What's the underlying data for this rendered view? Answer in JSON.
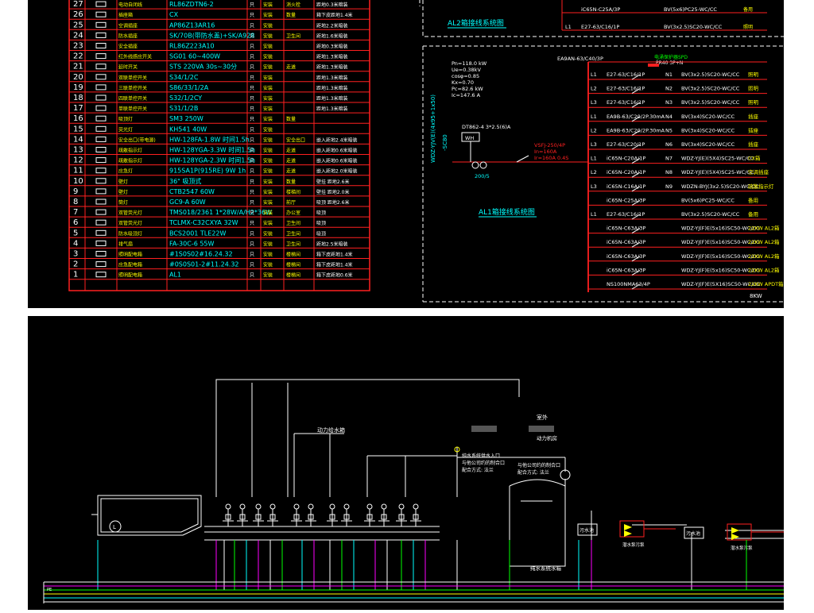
{
  "top": {
    "legend_rows": [
      {
        "no": "27",
        "name": "电动自闭线",
        "model": "RL86ZDTN6-2",
        "unit": "只",
        "install": "距地0.3米暗装",
        "qty": "",
        "mark": "消火栓"
      },
      {
        "no": "26",
        "name": "插座箱",
        "model": "CX",
        "unit": "只",
        "install": "箱下皮距地1.4米",
        "qty": "",
        "mark": "数量"
      },
      {
        "no": "25",
        "name": "空调插座",
        "model": "AP86Z13AR16",
        "unit": "只",
        "install": "距地2.2米暗装",
        "qty": "",
        "mark": ""
      },
      {
        "no": "24",
        "name": "防水插座",
        "model": "SK/70B(带防水盖)+SK/A928",
        "unit": "只",
        "install": "距地1.6米暗装",
        "qty": "",
        "mark": "卫生间"
      },
      {
        "no": "23",
        "name": "安全插座",
        "model": "RL86Z223A10",
        "unit": "只",
        "install": "距地0.3米暗装",
        "qty": "",
        "mark": ""
      },
      {
        "no": "22",
        "name": "红外线感应开关",
        "model": "SG01 60~400W",
        "unit": "只",
        "install": "距地1.3米暗装",
        "qty": "",
        "mark": ""
      },
      {
        "no": "21",
        "name": "延时开关",
        "model": "STS 220VA 30s~30分",
        "unit": "只",
        "install": "距地1.3米暗装",
        "qty": "",
        "mark": "走道"
      },
      {
        "no": "20",
        "name": "双联单控开关",
        "model": "S34/1/2C",
        "unit": "只",
        "install": "距地1.3米暗装",
        "qty": "",
        "mark": ""
      },
      {
        "no": "19",
        "name": "三联单控开关",
        "model": "S86/33/1/2A",
        "unit": "只",
        "install": "距地1.3米暗装",
        "qty": "",
        "mark": ""
      },
      {
        "no": "18",
        "name": "四联单控开关",
        "model": "S32/1/2CY",
        "unit": "只",
        "install": "距地1.3米暗装",
        "qty": "",
        "mark": ""
      },
      {
        "no": "17",
        "name": "单联单控开关",
        "model": "S31/1/2B",
        "unit": "只",
        "install": "距地1.3米暗装",
        "qty": "",
        "mark": ""
      },
      {
        "no": "16",
        "name": "吸顶灯",
        "model": "SM3 250W",
        "unit": "只",
        "install": "",
        "qty": "",
        "mark": "数量"
      },
      {
        "no": "15",
        "name": "荧光灯",
        "model": "KH541 40W",
        "unit": "只",
        "install": "",
        "qty": "",
        "mark": ""
      },
      {
        "no": "14",
        "name": "安全出口(带电源)",
        "model": "HW-128FA-1.8W 时间1.5h",
        "unit": "只",
        "install": "嵌入距地2.4米暗装",
        "qty": "",
        "mark": "安全出口"
      },
      {
        "no": "13",
        "name": "疏散指示灯",
        "model": "HW-128YGA-3.3W 时间1.5h",
        "unit": "只",
        "install": "嵌入距地0.6米暗装",
        "qty": "",
        "mark": "走道"
      },
      {
        "no": "12",
        "name": "疏散指示灯",
        "model": "HW-128YGA-2.3W 时间1.5h",
        "unit": "只",
        "install": "嵌入距地0.6米暗装",
        "qty": "",
        "mark": "走道"
      },
      {
        "no": "11",
        "name": "应急灯",
        "model": "915SA1P(915RE) 9W 1h",
        "unit": "只",
        "install": "嵌入距地2.0米暗装",
        "qty": "",
        "mark": "走道"
      },
      {
        "no": "10",
        "name": "壁灯",
        "model": "36\" 吸顶式",
        "unit": "只",
        "install": "壁挂 距地2.6米",
        "qty": "",
        "mark": "数量"
      },
      {
        "no": "9",
        "name": "壁灯",
        "model": "CTB2547 60W",
        "unit": "只",
        "install": "壁挂 距地2.0米",
        "qty": "",
        "mark": "楼梯间"
      },
      {
        "no": "8",
        "name": "筒灯",
        "model": "GC9-A 60W",
        "unit": "只",
        "install": "吸顶 距地2.6米",
        "qty": "",
        "mark": "前厅"
      },
      {
        "no": "7",
        "name": "双管荧光灯",
        "model": "TMS018/2361 1*28W/A/H2*36W",
        "unit": "只",
        "install": "吸顶",
        "qty": "",
        "mark": "办公室"
      },
      {
        "no": "6",
        "name": "双管荧光灯",
        "model": "TCLMX-C32CXYA 32W",
        "unit": "只",
        "install": "吸顶",
        "qty": "",
        "mark": "卫生间"
      },
      {
        "no": "5",
        "name": "防水吸顶灯",
        "model": "BCS2001 TLE22W",
        "unit": "只",
        "install": "吸顶",
        "qty": "",
        "mark": "卫生间"
      },
      {
        "no": "4",
        "name": "排气扇",
        "model": "FA-30C-6 55W",
        "unit": "只",
        "install": "距地2.5米暗装",
        "qty": "",
        "mark": "卫生间"
      },
      {
        "no": "3",
        "name": "照明配电箱",
        "model": "#1S0S02#16.24.32",
        "unit": "只",
        "install": "箱下皮距地1.4米",
        "qty": "",
        "mark": "楼梯间"
      },
      {
        "no": "2",
        "name": "应急配电箱",
        "model": "#0S0S01-2#11.24.32",
        "unit": "只",
        "install": "箱下皮距地1.4米",
        "qty": "",
        "mark": "楼梯间"
      },
      {
        "no": "1",
        "name": "照明配电箱",
        "model": "AL1",
        "unit": "只",
        "install": "箱下皮距地0.6米",
        "qty": "",
        "mark": "楼梯间"
      }
    ],
    "col_unit_label": "只",
    "col_install_label": "安装",
    "al2_title": "AL2箱接线系统图",
    "al1_title": "AL1箱接线系统图",
    "al2_top_circuits": [
      {
        "breaker": "iC65N-C25A/3P",
        "cable": "BV(5x6)PC25-WC/CC",
        "note": "备用"
      },
      {
        "phase": "L1",
        "breaker": "E27-63/C16/1P",
        "cable": "BV(3x2.5)SC20-WC/CC",
        "note": "照明"
      }
    ],
    "params": [
      "Pn=118.0 kW",
      "Ue=0.38kV",
      "cosφ=0.85",
      "Kx=0.70",
      "Pc=82.6 kW",
      "Ic=147.6 A"
    ],
    "main_breaker": "EA9AN-63/C40/3P",
    "spd": "电涌保护器SPD",
    "spd_model": "PR40 3P+N",
    "meter": "DT862-4 3*2.5(6)A",
    "meter_box": "WH",
    "incoming": "VSFJ-250/4P",
    "incoming2": "In=160A",
    "incoming3": "Ir=160A 0.4S",
    "transformer": "200/5",
    "vertical_cable": "WDZ-YJV(E)(4x95+1x50)",
    "vertical_cable2": "-SC80",
    "circuits": [
      {
        "phase": "L1",
        "breaker": "E27-63/C16/1P",
        "n": "N1",
        "cable": "BV(3x2.5)SC20-WC/CC",
        "note": "照明"
      },
      {
        "phase": "L2",
        "breaker": "E27-63/C16/1P",
        "n": "N2",
        "cable": "BV(3x2.5)SC20-WC/CC",
        "note": "照明"
      },
      {
        "phase": "L3",
        "breaker": "E27-63/C16/1P",
        "n": "N3",
        "cable": "BV(3x2.5)SC20-WC/CC",
        "note": "照明"
      },
      {
        "phase": "L1",
        "breaker": "EA9B-63/C20/2P.30mA",
        "n": "N4",
        "cable": "BV(3x4)SC20-WC/CC",
        "note": "插座"
      },
      {
        "phase": "L2",
        "breaker": "EA9B-63/C20/2P.30mA",
        "n": "N5",
        "cable": "BV(3x4)SC20-WC/CC",
        "note": "插座"
      },
      {
        "phase": "L3",
        "breaker": "E27-63/C20/1P",
        "n": "N6",
        "cable": "BV(3x4)SC20-WC/CC",
        "note": "插座"
      },
      {
        "phase": "L1",
        "breaker": "iC65N-C20A/1P",
        "n": "N7",
        "cable": "WDZ-YJ(E)(5X4)SC25-WC/CC",
        "note": "CX箱"
      },
      {
        "phase": "L2",
        "breaker": "iC65N-C20A/1P",
        "n": "N8",
        "cable": "WDZ-YJ(E)(5X4)SC25-WC/CC",
        "note": "空调插座"
      },
      {
        "phase": "L3",
        "breaker": "iC65N-C16A/1P",
        "n": "N9",
        "cable": "WDZN-BYJ(3x2.5)SC20-WC/CC",
        "note": "疏散指示灯"
      },
      {
        "phase": "",
        "breaker": "iC65N-C25A/3P",
        "n": "",
        "cable": "BV(5x6)PC25-WC/CC",
        "note": "备用"
      },
      {
        "phase": "L1",
        "breaker": "E27-63/C16/1P",
        "n": "",
        "cable": "BV(3x2.5)SC20-WC/CC",
        "note": "备用"
      },
      {
        "phase": "",
        "breaker": "iC65N-C63A/3P",
        "n": "",
        "cable": "WDZ-YJ(F)E(5x16)SC50-WC/CC",
        "note": "22KW AL2箱"
      },
      {
        "phase": "",
        "breaker": "iC65N-C63A/3P",
        "n": "",
        "cable": "WDZ-YJ(F)E(5x16)SC50-WC/CC",
        "note": "22KW AL2箱"
      },
      {
        "phase": "",
        "breaker": "iC65N-C63A/3P",
        "n": "",
        "cable": "WDZ-YJ(F)E(5x16)SC50-WC/CC",
        "note": "22KW AL2箱"
      },
      {
        "phase": "",
        "breaker": "iC65N-C63A/3P",
        "n": "",
        "cable": "WDZ-YJ(F)E(5x16)SC50-WC/CC",
        "note": "22KW AL2箱"
      },
      {
        "phase": "",
        "breaker": "NS100NMA63/4P",
        "n": "",
        "cable": "WDZ-YJ(F)E(5X16)SC50-WC/CC",
        "note": "22KW APDT箱"
      }
    ],
    "last_note": "8KW"
  },
  "bottom": {
    "label_pump": "动力给水箱",
    "label_outdoor": "室外",
    "label_machine": "动力机房",
    "label_pure1": "纯水系统供水入口",
    "label_pure2": "与他公司约的制合口",
    "label_pure3": "配合方式: 法兰",
    "label_pure4": "与他公司约的制合口",
    "label_pure5": "配合方式: 法兰",
    "label_tank": "纯水系统水箱",
    "label_sewage1": "污水池",
    "label_sewage2": "污水池",
    "label_pump1": "潜水泵污泵",
    "label_pump2": "潜水泵污泵",
    "label_l": "L",
    "label_pe": "PE"
  },
  "colors": {
    "bg": "#000000",
    "red": "#ff2020",
    "cyan": "#00ffff",
    "white": "#ffffff",
    "yellow": "#ffff00",
    "green": "#00ff00",
    "magenta": "#ff00ff"
  }
}
